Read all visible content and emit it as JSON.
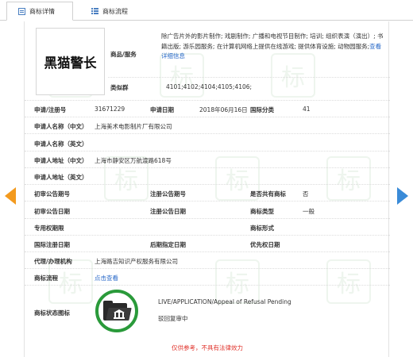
{
  "tabs": {
    "details_label": "商标详情",
    "process_label": "商标流程"
  },
  "trademark": {
    "logo_text": "黑猫警长",
    "goods_services_label": "商品/服务",
    "goods_services_text": "除广告片外的影片制作; 戏剧制作; 广播和电视节目制作; 培训; 组织表演（演出）; 书籍出版; 游乐园服务; 在计算机网络上提供在线游戏; 提供体育设施; 动物园服务;",
    "more_link": "查看详细信息",
    "similar_group_label": "类似群",
    "similar_group_value": "4101;4102;4104;4105;4106;"
  },
  "fields": {
    "reg_no_label": "申请/注册号",
    "reg_no_value": "31671229",
    "app_date_label": "申请日期",
    "app_date_value": "2018年06月16日",
    "intl_class_label": "国际分类",
    "intl_class_value": "41",
    "applicant_cn_label": "申请人名称（中文）",
    "applicant_cn_value": "上海美术电影制片厂有限公司",
    "applicant_en_label": "申请人名称（英文）",
    "address_cn_label": "申请人地址（中文）",
    "address_cn_value": "上海市静安区万航渡路618号",
    "address_en_label": "申请人地址（英文）",
    "prelim_no_label": "初审公告期号",
    "reg_ann_no_label": "注册公告期号",
    "shared_label": "是否共有商标",
    "shared_value": "否",
    "prelim_date_label": "初审公告日期",
    "reg_ann_date_label": "注册公告日期",
    "tm_type_label": "商标类型",
    "tm_type_value": "一般",
    "exclusive_period_label": "专用权期限",
    "tm_form_label": "商标形式",
    "intl_reg_date_label": "国际注册日期",
    "later_designation_label": "后期指定日期",
    "priority_date_label": "优先权日期",
    "agent_label": "代理/办理机构",
    "agent_value": "上海路吉知识产权服务有限公司",
    "process_label": "商标流程",
    "process_link": "点击查看",
    "status_icon_label": "商标状态图标"
  },
  "status": {
    "title": "LIVE/APPLICATION/Appeal of Refusal Pending",
    "desc": "驳回复审中",
    "icon": "folder-bank-icon",
    "ring_color": "#2a9a3a"
  },
  "disclaimer": "仅供参考，不具有法律效力",
  "watermark_char": "标",
  "colors": {
    "link": "#2a6ac8",
    "disclaimer": "#e0322a",
    "prev_arrow": "#f39a1e",
    "next_arrow": "#3a8bd8"
  }
}
